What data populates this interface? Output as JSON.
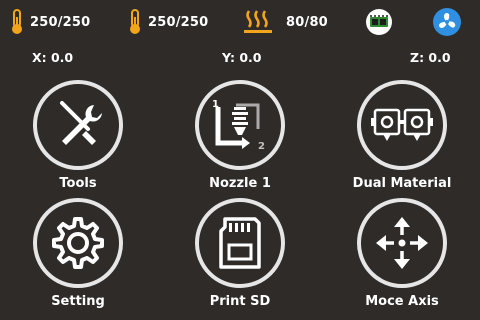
{
  "status": {
    "extruder1": {
      "icon": "thermometer-icon",
      "value": "250/250"
    },
    "extruder2": {
      "icon": "thermometer-icon",
      "value": "250/250"
    },
    "bed": {
      "icon": "heated-bed-icon",
      "value": "80/80"
    },
    "connection_icon": "board-icon",
    "fan_icon": "fan-icon"
  },
  "axes": {
    "x": "X: 0.0",
    "y": "Y: 0.0",
    "z": "Z: 0.0"
  },
  "tiles": [
    {
      "label": "Tools",
      "icon": "tools-icon"
    },
    {
      "label": "Nozzle 1",
      "icon": "nozzle-icon"
    },
    {
      "label": "Dual Material",
      "icon": "dual-extruder-icon"
    },
    {
      "label": "Setting",
      "icon": "gear-icon"
    },
    {
      "label": "Print SD",
      "icon": "sd-card-icon"
    },
    {
      "label": "Moce Axis",
      "icon": "move-axis-icon"
    }
  ],
  "colors": {
    "background": "#2f2b29",
    "thermo": "#f2a51a",
    "fan": "#2f8fe0",
    "ring": "#e6e6e6"
  }
}
